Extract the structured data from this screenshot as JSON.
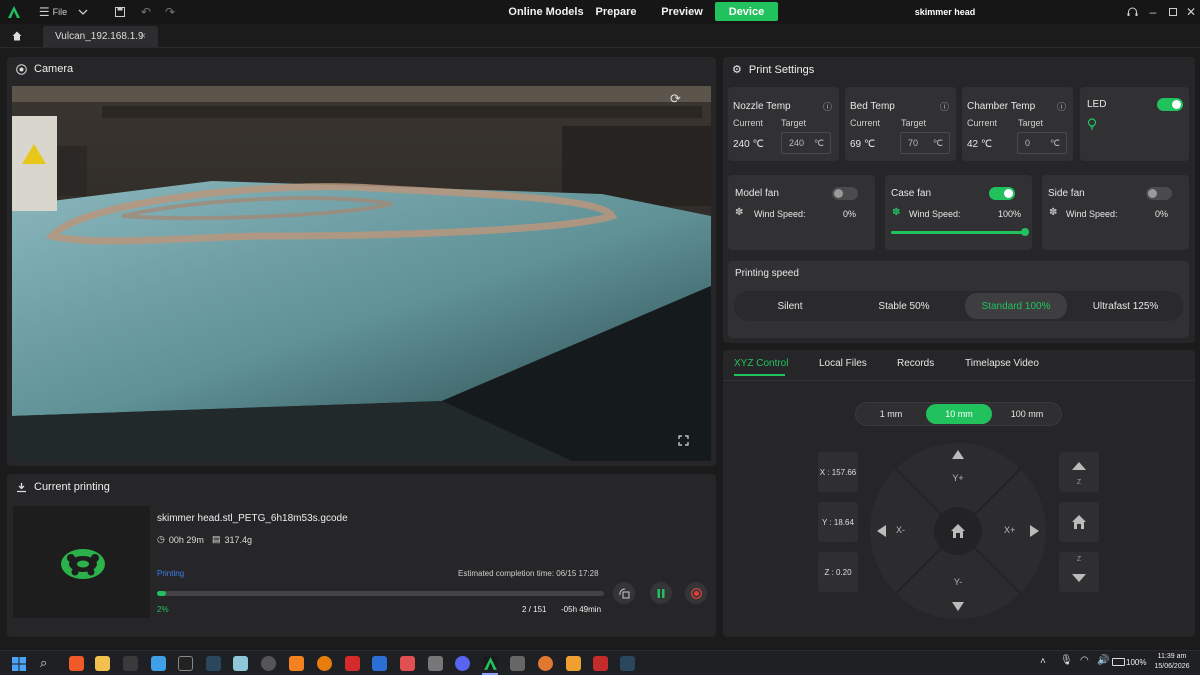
{
  "topbar": {
    "file_label": "File",
    "nav": [
      "Online Models",
      "Prepare",
      "Preview",
      "Device"
    ],
    "active_nav": "Device",
    "project_title": "skimmer head",
    "accent": "#21c25e"
  },
  "tabs": {
    "device_tab": "Vulcan_192.168.1.9",
    "close_glyph": "×"
  },
  "camera": {
    "title": "Camera"
  },
  "current_printing": {
    "title": "Current printing",
    "file_name": "skimmer head.stl_PETG_6h18m53s.gcode",
    "time_used": "00h 29m",
    "weight": "317.4g",
    "status": "Printing",
    "estimated_completion": "Estimated completion time: 06/15 17:28",
    "progress_percent": 2,
    "progress_label": "2%",
    "layers": "2 / 151",
    "time_remaining": "-05h 49min"
  },
  "print_settings": {
    "title": "Print Settings",
    "temps": [
      {
        "name": "Nozzle Temp",
        "current_label": "Current",
        "target_label": "Target",
        "current": "240 ℃",
        "target": "240",
        "unit": "℃"
      },
      {
        "name": "Bed Temp",
        "current_label": "Current",
        "target_label": "Target",
        "current": "69 ℃",
        "target": "70",
        "unit": "℃"
      },
      {
        "name": "Chamber Temp",
        "current_label": "Current",
        "target_label": "Target",
        "current": "42 ℃",
        "target": "0",
        "unit": "℃"
      }
    ],
    "led": {
      "label": "LED",
      "on": true
    },
    "fans": [
      {
        "name": "Model fan",
        "speed_label": "Wind Speed:",
        "speed": "0%",
        "on": false
      },
      {
        "name": "Case fan",
        "speed_label": "Wind Speed:",
        "speed": "100%",
        "on": true,
        "level": 1.0
      },
      {
        "name": "Side fan",
        "speed_label": "Wind Speed:",
        "speed": "0%",
        "on": false
      }
    ],
    "printing_speed": {
      "title": "Printing speed",
      "options": [
        "Silent",
        "Stable 50%",
        "Standard 100%",
        "Ultrafast 125%"
      ],
      "selected": "Standard 100%"
    }
  },
  "control": {
    "tabs": [
      "XYZ Control",
      "Local Files",
      "Records",
      "Timelapse Video"
    ],
    "active_tab": "XYZ Control",
    "steps": [
      "1 mm",
      "10 mm",
      "100 mm"
    ],
    "selected_step": "10 mm",
    "x": "X : 157.66",
    "y": "Y : 18.64",
    "z": "Z : 0.20",
    "yplus": "Y+",
    "yminus": "Y-",
    "xminus": "X-",
    "xplus": "X+",
    "zlabel": "Z"
  },
  "taskbar": {
    "battery": "100%",
    "time": "11:39 am",
    "date": "15/06/2026"
  }
}
